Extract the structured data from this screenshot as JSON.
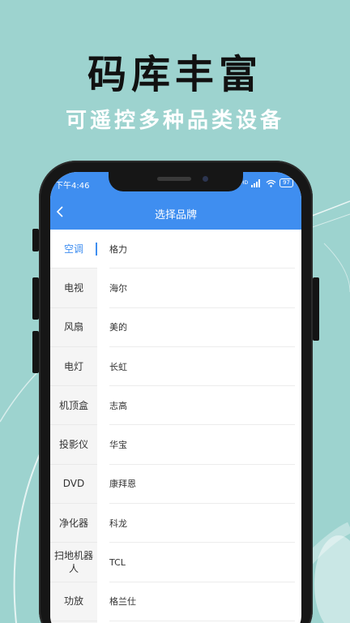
{
  "promo": {
    "headline": "码库丰富",
    "subline": "可遥控多种品类设备"
  },
  "status_bar": {
    "time": "下午4:46",
    "signal_label": "HD",
    "battery": "97"
  },
  "header": {
    "title": "选择品牌"
  },
  "sidebar": {
    "items": [
      {
        "label": "空调"
      },
      {
        "label": "电视"
      },
      {
        "label": "风扇"
      },
      {
        "label": "电灯"
      },
      {
        "label": "机顶盒"
      },
      {
        "label": "投影仪"
      },
      {
        "label": "DVD"
      },
      {
        "label": "净化器"
      },
      {
        "label": "扫地机器人"
      },
      {
        "label": "功放"
      }
    ]
  },
  "brands": {
    "items": [
      {
        "label": "格力"
      },
      {
        "label": "海尔"
      },
      {
        "label": "美的"
      },
      {
        "label": "长虹"
      },
      {
        "label": "志高"
      },
      {
        "label": "华宝"
      },
      {
        "label": "康拜恩"
      },
      {
        "label": "科龙"
      },
      {
        "label": "TCL"
      },
      {
        "label": "格兰仕"
      }
    ]
  },
  "colors": {
    "background": "#9dd3cf",
    "accent": "#3f8ef0"
  }
}
